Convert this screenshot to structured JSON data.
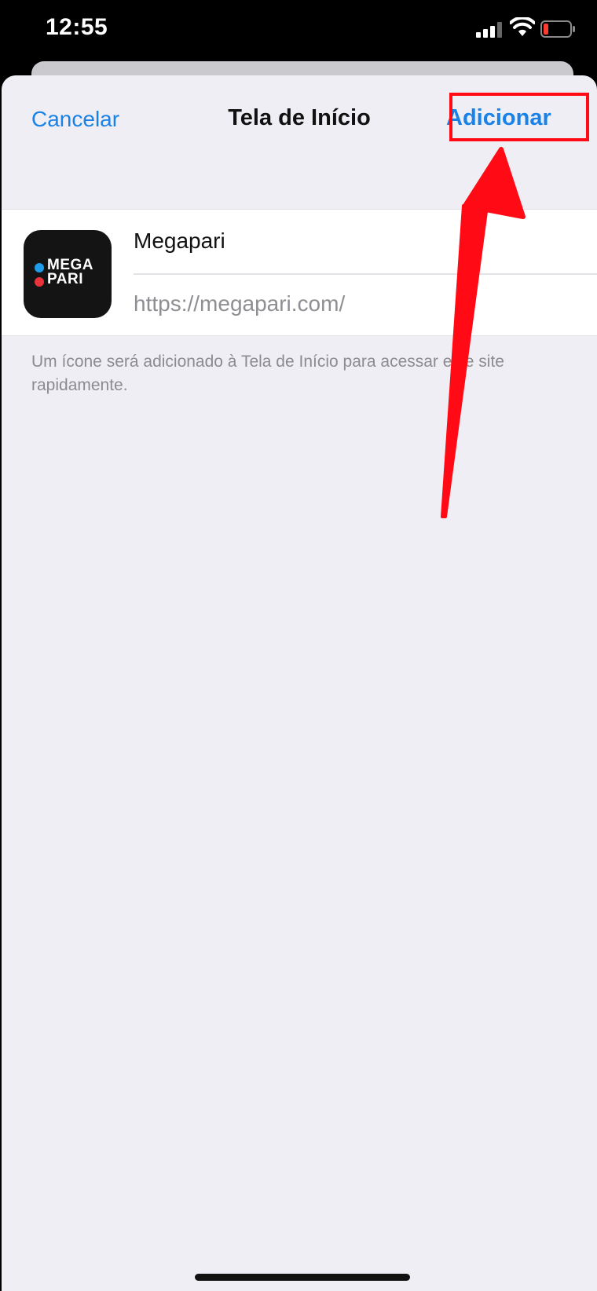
{
  "status_bar": {
    "time": "12:55",
    "icons": [
      "cellular-signal-icon",
      "wifi-icon",
      "battery-low-icon"
    ]
  },
  "nav": {
    "cancel_label": "Cancelar",
    "title": "Tela de Início",
    "add_label": "Adicionar"
  },
  "bookmark": {
    "icon_logo_text": "MEGA PARI",
    "name_value": "Megapari",
    "url_value": "https://megapari.com/"
  },
  "footnote": "Um ícone será adicionado à Tela de Início para acessar este site rapidamente.",
  "colors": {
    "accent": "#1a82e6",
    "annotation": "#ff0a15",
    "background": "#efeef4"
  }
}
